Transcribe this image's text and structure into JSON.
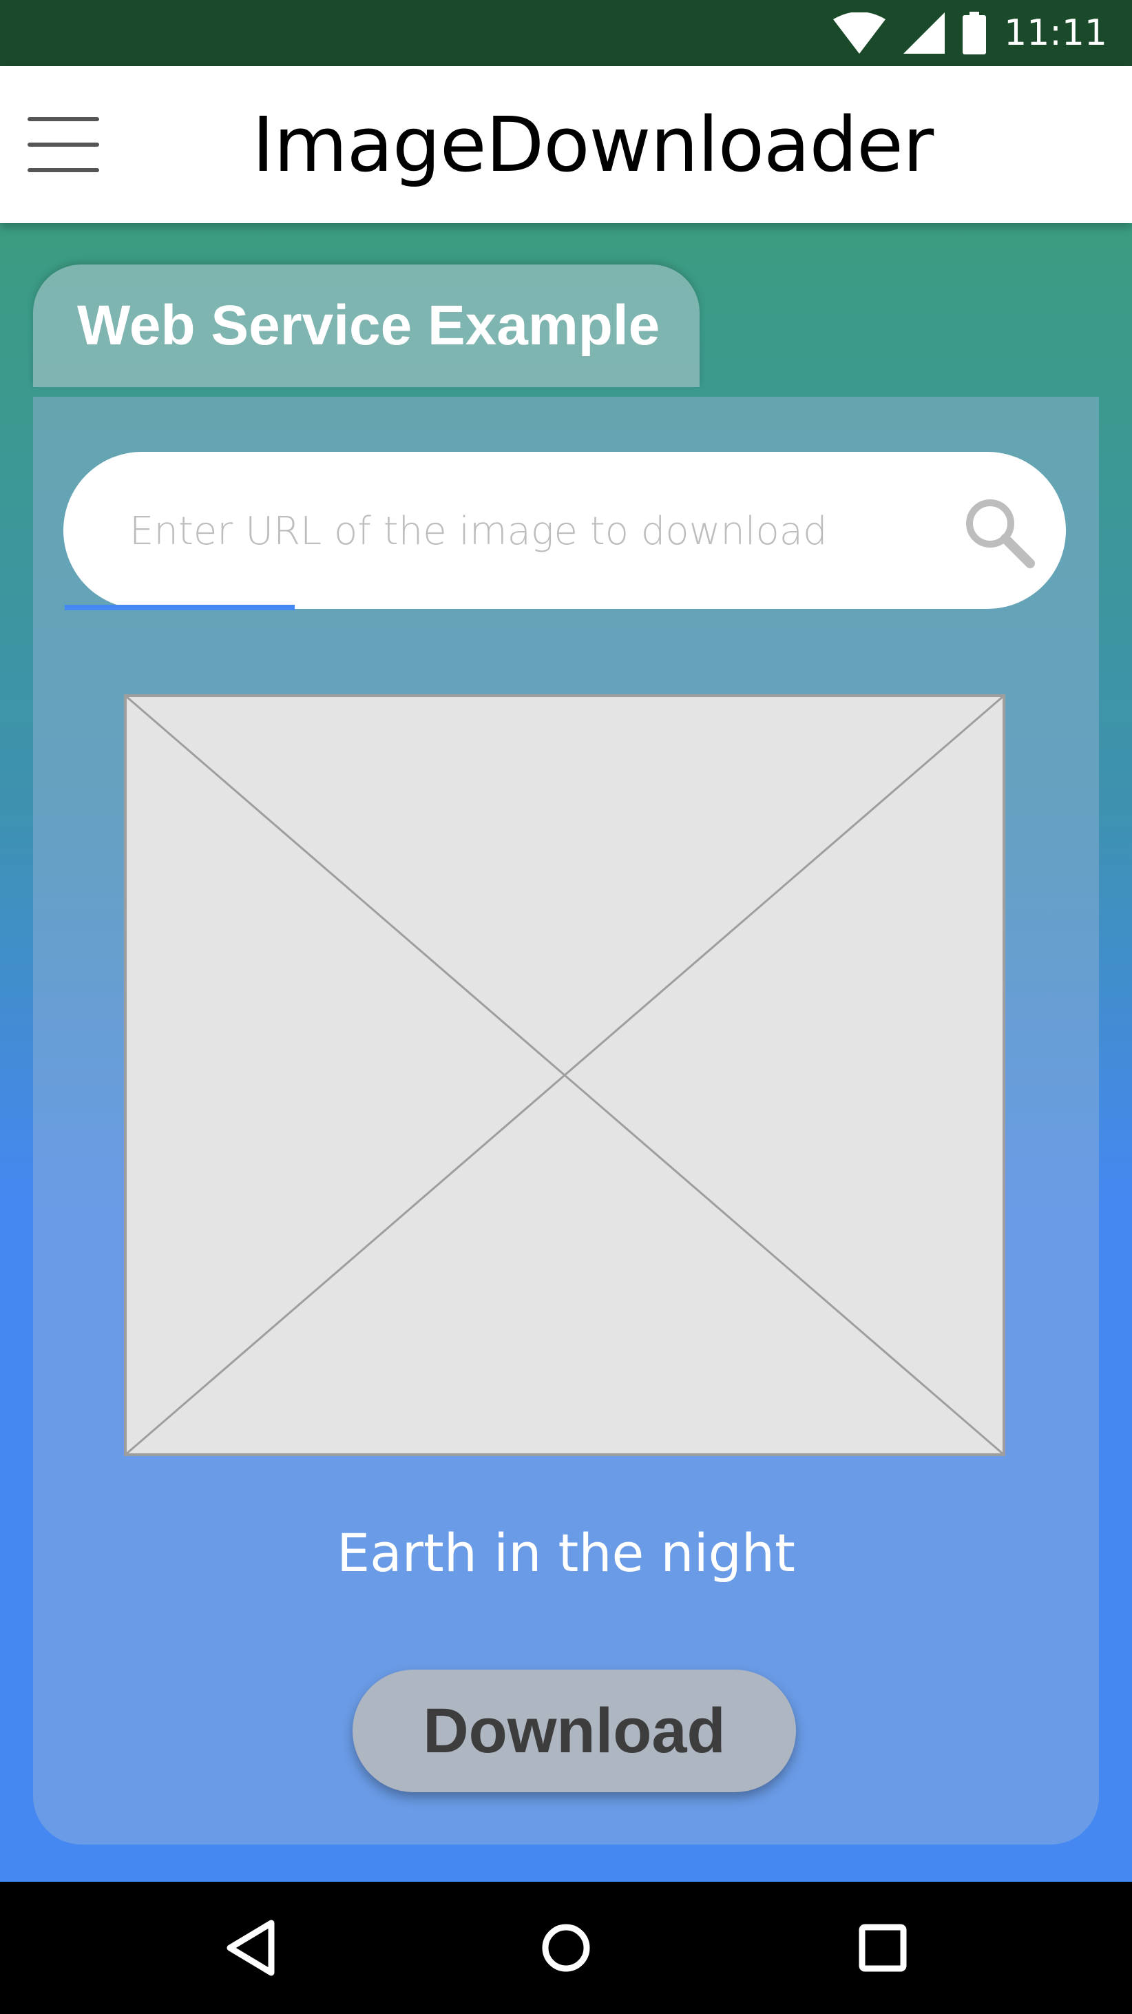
{
  "status_bar": {
    "time": "11:11",
    "icons": [
      "wifi-icon",
      "signal-icon",
      "battery-icon"
    ]
  },
  "app_bar": {
    "title": "ImageDownloader",
    "menu_icon": "hamburger-menu-icon"
  },
  "tab": {
    "label": "Web Service Example"
  },
  "search": {
    "placeholder": "Enter URL of the image to download",
    "value": "",
    "icon": "search-icon"
  },
  "image": {
    "caption": "Earth in the night"
  },
  "actions": {
    "download_label": "Download"
  },
  "nav_bar": {
    "items": [
      "back-icon",
      "home-icon",
      "recents-icon"
    ]
  },
  "colors": {
    "status_bar": "#1b4a2a",
    "accent": "#4588f2",
    "button": "#aeb6c2"
  }
}
